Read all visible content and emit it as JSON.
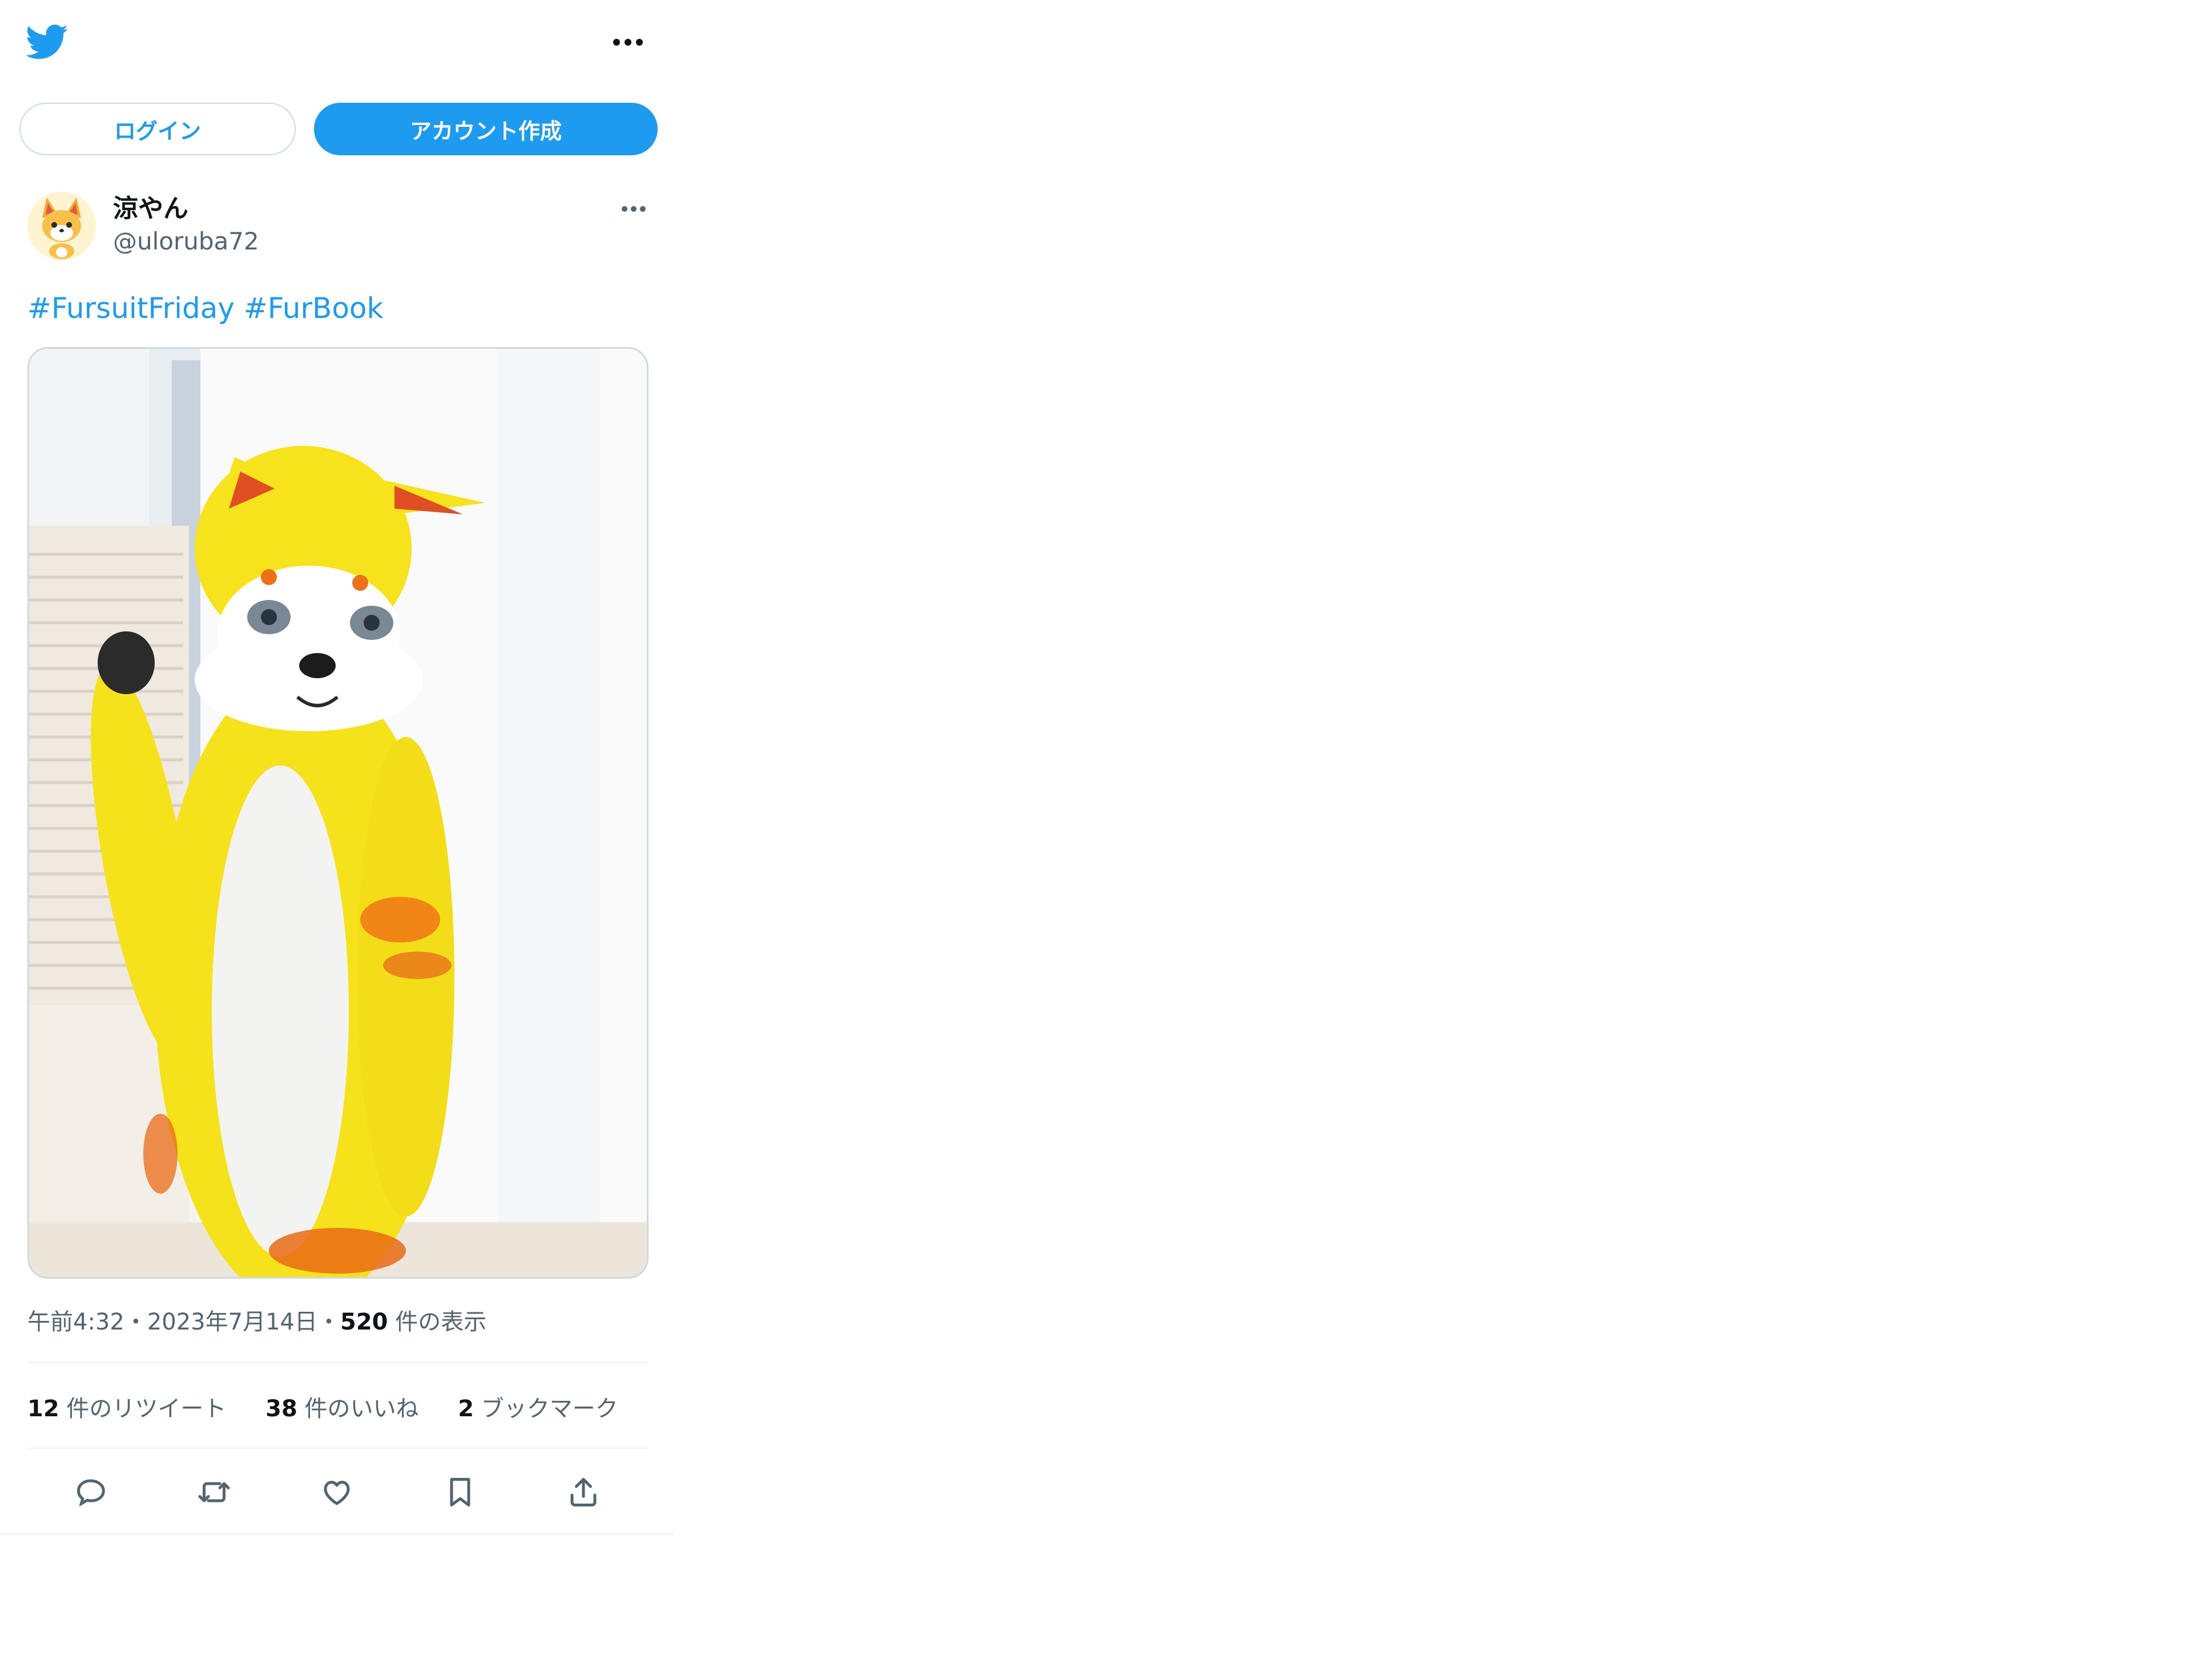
{
  "header": {
    "logo_icon": "twitter-bird-icon",
    "more_icon": "more-horizontal-icon",
    "brand_color": "#1d9bf0"
  },
  "auth": {
    "login_label": "ログイン",
    "signup_label": "アカウント作成"
  },
  "tweet": {
    "author": {
      "display_name": "涼やん",
      "handle": "@uloruba72",
      "avatar_icon": "fox-avatar"
    },
    "hashtags": [
      "#FursuitFriday",
      "#FurBook"
    ],
    "media_alt": "yellow fox fursuit photo",
    "time": "午前4:32",
    "separator": "・",
    "date": "2023年7月14日",
    "views_count": "520",
    "views_label": " 件の表示",
    "stats": {
      "retweets_count": "12",
      "retweets_label": " 件のリツイート",
      "likes_count": "38",
      "likes_label": " 件のいいね",
      "bookmarks_count": "2",
      "bookmarks_label": " ブックマーク"
    },
    "actions": [
      "reply-icon",
      "retweet-icon",
      "like-icon",
      "bookmark-icon",
      "share-icon"
    ]
  }
}
